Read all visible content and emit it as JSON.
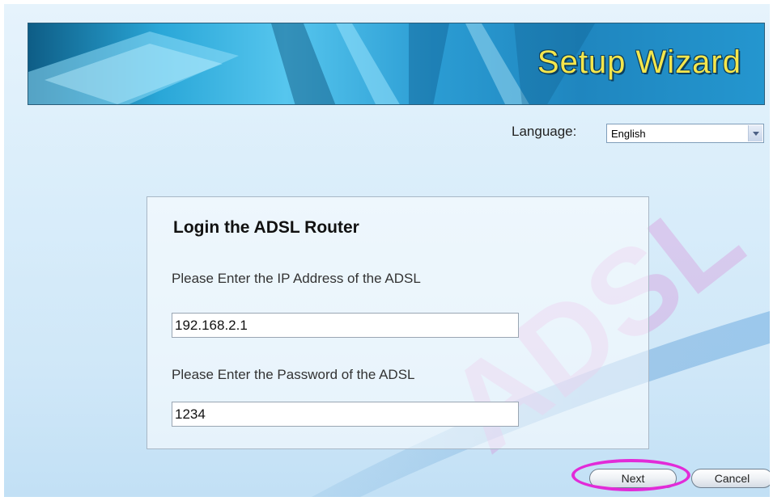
{
  "banner": {
    "title": "Setup Wizard"
  },
  "language": {
    "label": "Language:",
    "selected": "English"
  },
  "panel": {
    "title": "Login the ADSL Router",
    "ip_label": "Please Enter the IP Address of the ADSL",
    "ip_value": "192.168.2.1",
    "password_label": "Please Enter the Password of the ADSL",
    "password_value": "1234"
  },
  "watermark": {
    "text": "ADSL"
  },
  "buttons": {
    "next": "Next",
    "cancel": "Cancel"
  },
  "colors": {
    "highlight": "#e22bd8",
    "banner_title": "#f4e64c",
    "background": "#d9edfa"
  }
}
